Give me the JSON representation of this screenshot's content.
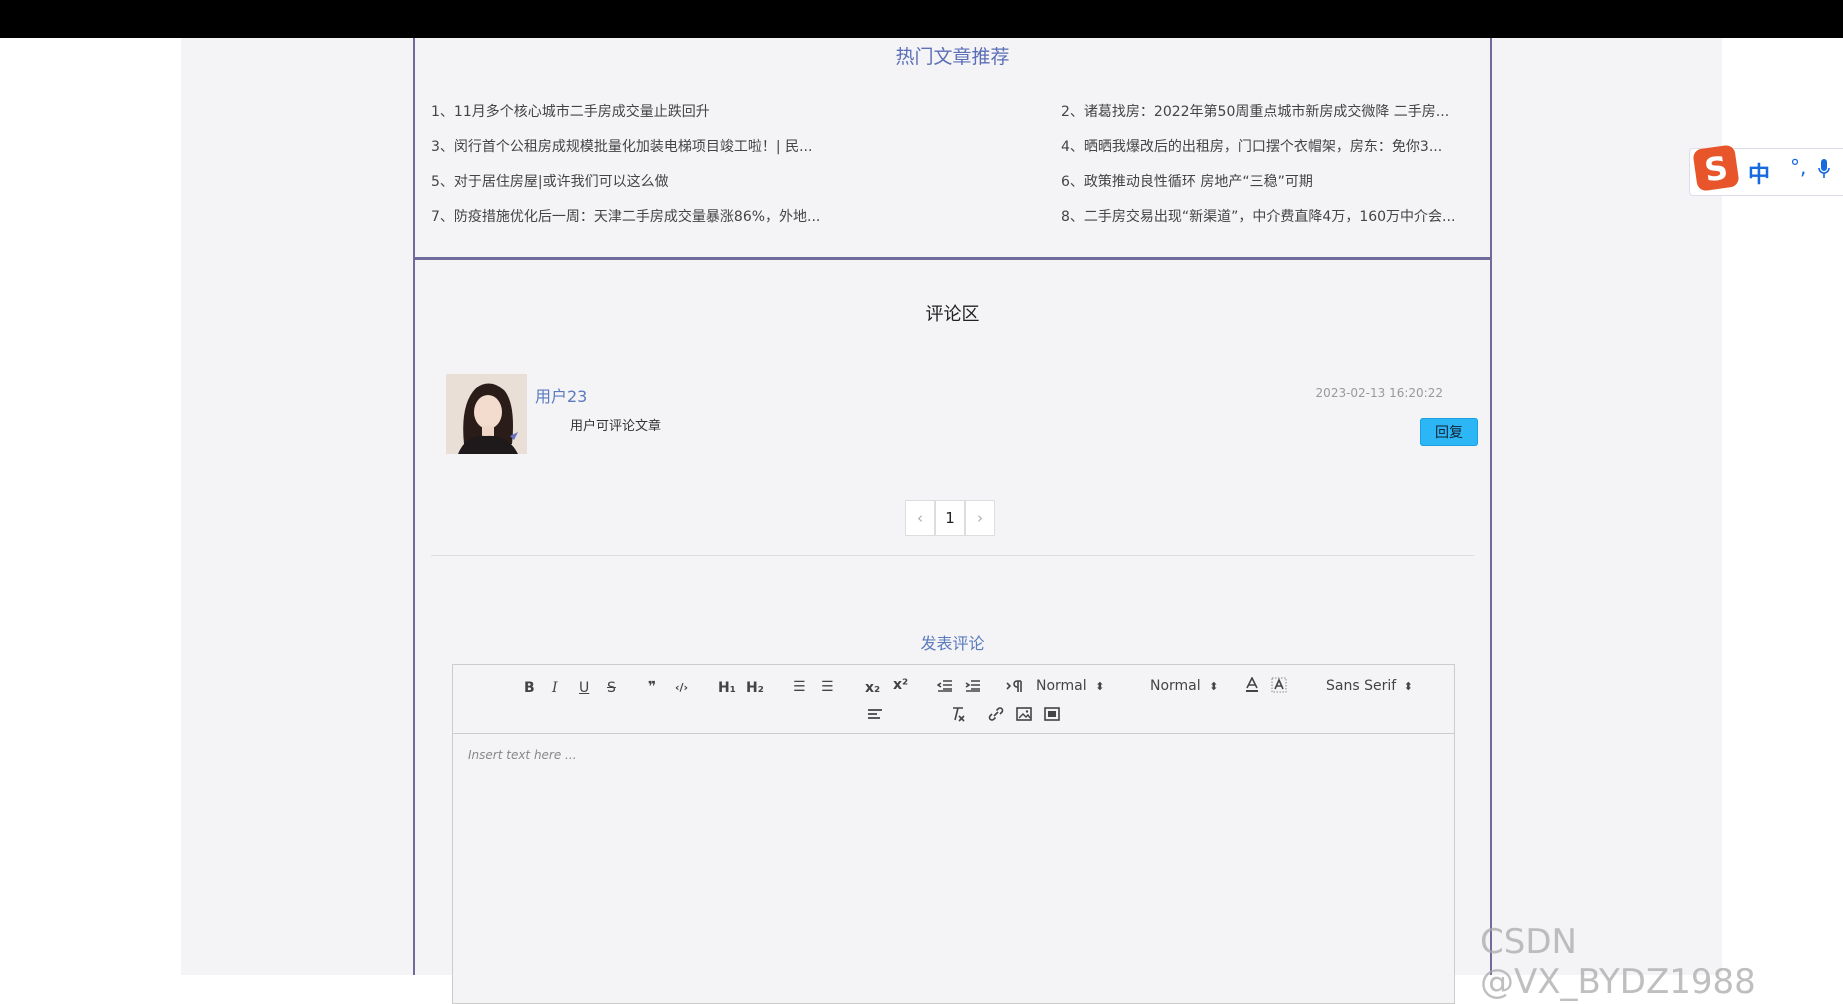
{
  "hot_articles": {
    "title": "热门文章推荐",
    "items": [
      "1、11月多个核心城市二手房成交量止跌回升",
      "2、诸葛找房：2022年第50周重点城市新房成交微降 二手房...",
      "3、闵行首个公租房成规模批量化加装电梯项目竣工啦！| 民...",
      "4、晒晒我爆改后的出租房，门口摆个衣帽架，房东：免你3...",
      "5、对于居住房屋|或许我们可以这么做",
      "6、政策推动良性循环 房地产“三稳”可期",
      "7、防疫措施优化后一周：天津二手房成交量暴涨86%，外地...",
      "8、二手房交易出现“新渠道”，中介费直降4万，160万中介会..."
    ]
  },
  "comments": {
    "title": "评论区",
    "items": [
      {
        "user": "用户23",
        "time": "2023-02-13 16:20:22",
        "text": "用户可评论文章",
        "reply_label": "回复"
      }
    ],
    "pagination": {
      "prev": "‹",
      "current": "1",
      "next": "›"
    }
  },
  "post": {
    "title": "发表评论",
    "placeholder": "Insert text here ...",
    "toolbar": {
      "bold": "B",
      "italic": "I",
      "underline": "U",
      "strike": "S",
      "quote": "❞",
      "code": "‹/›",
      "h1": "H₁",
      "h2": "H₂",
      "ordered": "☰",
      "bullet": "☰",
      "sub": "x₂",
      "sup": "x²",
      "size_select": "Normal",
      "header_select": "Normal",
      "font_select": "Sans Serif",
      "select_arrow": "⬍"
    }
  },
  "ime": {
    "logo": "S",
    "mode": "中",
    "punc": "°,"
  },
  "watermark": "CSDN @VX_BYDZ1988"
}
